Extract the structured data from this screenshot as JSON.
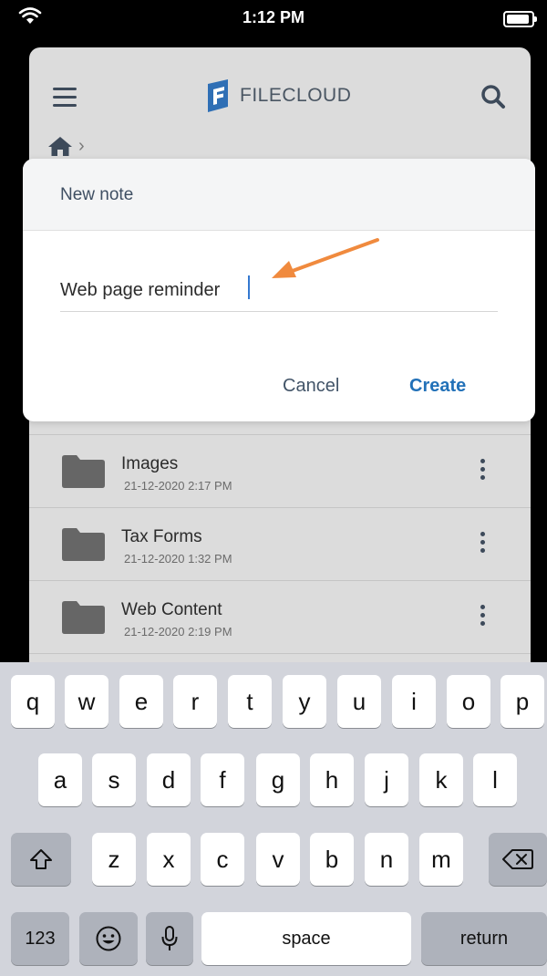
{
  "status_bar": {
    "time": "1:12 PM"
  },
  "app": {
    "logo_text": "FILECLOUD"
  },
  "dialog": {
    "title": "New note",
    "input_value": "Web page reminder",
    "cancel_label": "Cancel",
    "create_label": "Create"
  },
  "files": [
    {
      "name": "Images",
      "date": "21-12-2020 2:17 PM"
    },
    {
      "name": "Tax Forms",
      "date": "21-12-2020 1:32 PM"
    },
    {
      "name": "Web Content",
      "date": "21-12-2020 2:19 PM"
    }
  ],
  "keyboard": {
    "row1": [
      "q",
      "w",
      "e",
      "r",
      "t",
      "y",
      "u",
      "i",
      "o",
      "p"
    ],
    "row2": [
      "a",
      "s",
      "d",
      "f",
      "g",
      "h",
      "j",
      "k",
      "l"
    ],
    "row3": [
      "z",
      "x",
      "c",
      "v",
      "b",
      "n",
      "m"
    ],
    "numbers_label": "123",
    "space_label": "space",
    "return_label": "return"
  },
  "colors": {
    "accent": "#2271b8",
    "annotation_arrow": "#f08a3e"
  }
}
